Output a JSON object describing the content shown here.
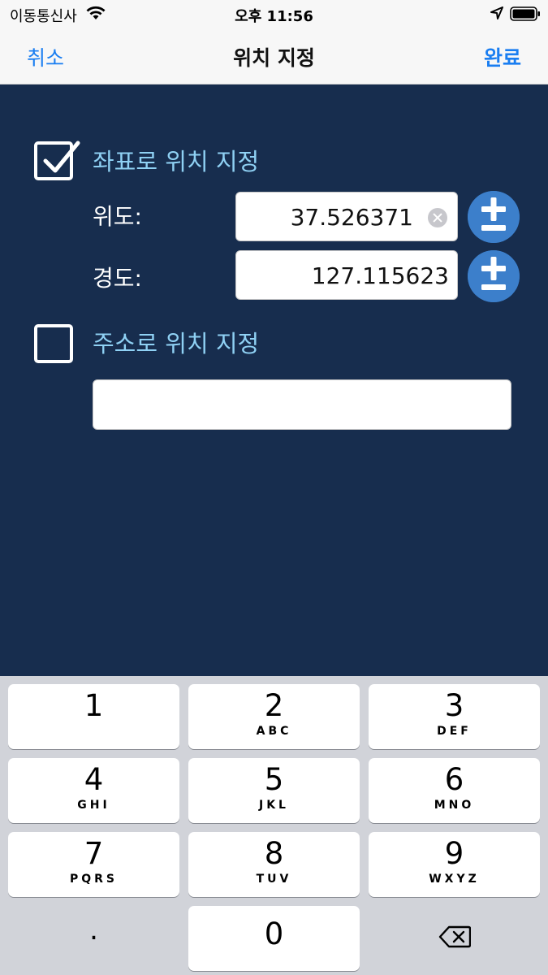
{
  "status": {
    "carrier": "이동통신사",
    "time": "오후 11:56"
  },
  "nav": {
    "cancel": "취소",
    "title": "위치 지정",
    "done": "완료"
  },
  "coordinate_section": {
    "label": "좌표로 위치 지정",
    "checked": true,
    "latitude_label": "위도:",
    "latitude_value": "37.526371",
    "longitude_label": "경도:",
    "longitude_value": "127.115623"
  },
  "address_section": {
    "label": "주소로 위치 지정",
    "checked": false,
    "address_value": ""
  },
  "keypad": {
    "keys": [
      {
        "num": "1",
        "letters": ""
      },
      {
        "num": "2",
        "letters": "ABC"
      },
      {
        "num": "3",
        "letters": "DEF"
      },
      {
        "num": "4",
        "letters": "GHI"
      },
      {
        "num": "5",
        "letters": "JKL"
      },
      {
        "num": "6",
        "letters": "MNO"
      },
      {
        "num": "7",
        "letters": "PQRS"
      },
      {
        "num": "8",
        "letters": "TUV"
      },
      {
        "num": "9",
        "letters": "WXYZ"
      },
      {
        "num": "0",
        "letters": ""
      }
    ],
    "decimal": "."
  },
  "colors": {
    "accent": "#1a7ef1",
    "panel": "#172d4e",
    "section_label": "#8fd1f4",
    "plus_minus": "#3c7fcb"
  }
}
